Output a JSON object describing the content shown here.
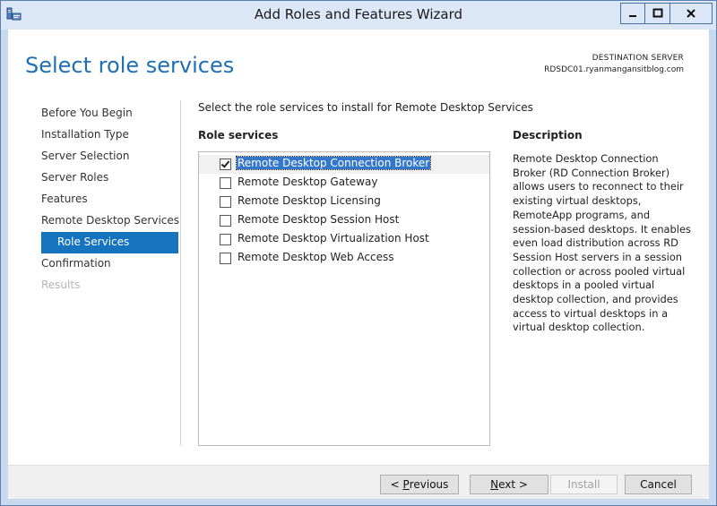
{
  "window": {
    "title": "Add Roles and Features Wizard"
  },
  "header": {
    "page_title": "Select role services",
    "destination_label": "DESTINATION SERVER",
    "destination_server": "RDSDC01.ryanmangansitblog.com"
  },
  "nav": {
    "items": [
      {
        "label": "Before You Begin",
        "state": "normal"
      },
      {
        "label": "Installation Type",
        "state": "normal"
      },
      {
        "label": "Server Selection",
        "state": "normal"
      },
      {
        "label": "Server Roles",
        "state": "normal"
      },
      {
        "label": "Features",
        "state": "normal"
      },
      {
        "label": "Remote Desktop Services",
        "state": "normal"
      },
      {
        "label": "Role Services",
        "state": "active"
      },
      {
        "label": "Confirmation",
        "state": "normal"
      },
      {
        "label": "Results",
        "state": "disabled"
      }
    ]
  },
  "main": {
    "instruction": "Select the role services to install for Remote Desktop Services",
    "role_services_header": "Role services",
    "role_services": [
      {
        "label": "Remote Desktop Connection Broker",
        "checked": true,
        "selected": true
      },
      {
        "label": "Remote Desktop Gateway",
        "checked": false,
        "selected": false
      },
      {
        "label": "Remote Desktop Licensing",
        "checked": false,
        "selected": false
      },
      {
        "label": "Remote Desktop Session Host",
        "checked": false,
        "selected": false
      },
      {
        "label": "Remote Desktop Virtualization Host",
        "checked": false,
        "selected": false
      },
      {
        "label": "Remote Desktop Web Access",
        "checked": false,
        "selected": false
      }
    ],
    "description_header": "Description",
    "description": "Remote Desktop Connection Broker (RD Connection Broker) allows users to reconnect to their existing virtual desktops, RemoteApp programs, and session-based desktops. It enables even load distribution across RD Session Host servers in a session collection or across pooled virtual desktops in a pooled virtual desktop collection, and provides access to virtual desktops in a virtual desktop collection."
  },
  "footer": {
    "previous_prefix": "< ",
    "previous_key": "P",
    "previous_rest": "revious",
    "next_key": "N",
    "next_rest": "ext >",
    "install_label": "Install",
    "cancel_label": "Cancel"
  },
  "colors": {
    "accent": "#1e6fb4",
    "nav_active": "#1673be",
    "selection": "#3377cc"
  },
  "icons": {
    "app": "server-manager-icon",
    "minimize": "minimize-icon",
    "maximize": "maximize-icon",
    "close": "close-icon"
  }
}
